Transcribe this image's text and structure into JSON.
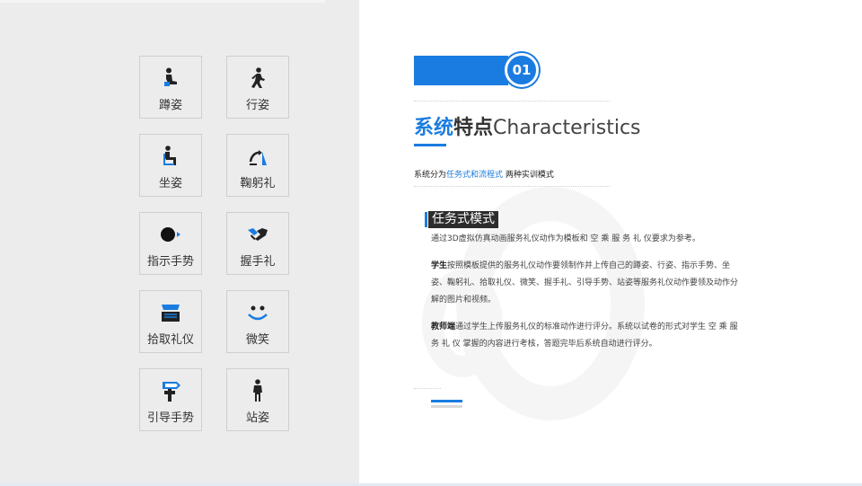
{
  "tiles": [
    {
      "label": "蹲姿",
      "icon": "squat-icon"
    },
    {
      "label": "行姿",
      "icon": "walking-icon"
    },
    {
      "label": "坐姿",
      "icon": "sitting-icon"
    },
    {
      "label": "鞠躬礼",
      "icon": "bow-icon"
    },
    {
      "label": "指示手势",
      "icon": "pointing-icon"
    },
    {
      "label": "握手礼",
      "icon": "handshake-icon"
    },
    {
      "label": "拾取礼仪",
      "icon": "pickup-icon"
    },
    {
      "label": "微笑",
      "icon": "smile-icon"
    },
    {
      "label": "引导手势",
      "icon": "signpost-icon"
    },
    {
      "label": "站姿",
      "icon": "standing-icon"
    }
  ],
  "section": {
    "number": "01",
    "title_blue": "系统",
    "title_dark": "特点",
    "title_en": "Characteristics",
    "subtitle_prefix": "系统分为",
    "subtitle_highlight": "任务式和流程式",
    "subtitle_suffix": " 两种实训模式"
  },
  "mode": {
    "title": "任务式模式",
    "intro": "通过3D虚拟仿真动画服务礼仪动作为模板和 空 乘 服 务 礼 仪要求为参考。",
    "student_label": "学生",
    "student_text": "按照模板提供的服务礼仪动作要领制作并上传自己的蹲姿、行姿、指示手势、坐姿、鞠躬礼、拾取礼仪、微笑、握手礼、引导手势、站姿等服务礼仪动作要领及动作分解的图片和视频。",
    "teacher_label": "教师端",
    "teacher_text": "通过学生上传服务礼仪的标准动作进行评分。系统以试卷的形式对学生 空 乘 服 务 礼 仪 掌握的内容进行考核，答题完毕后系统自动进行评分。"
  },
  "colors": {
    "accent": "#1a7ce0",
    "panel": "#ececec"
  }
}
